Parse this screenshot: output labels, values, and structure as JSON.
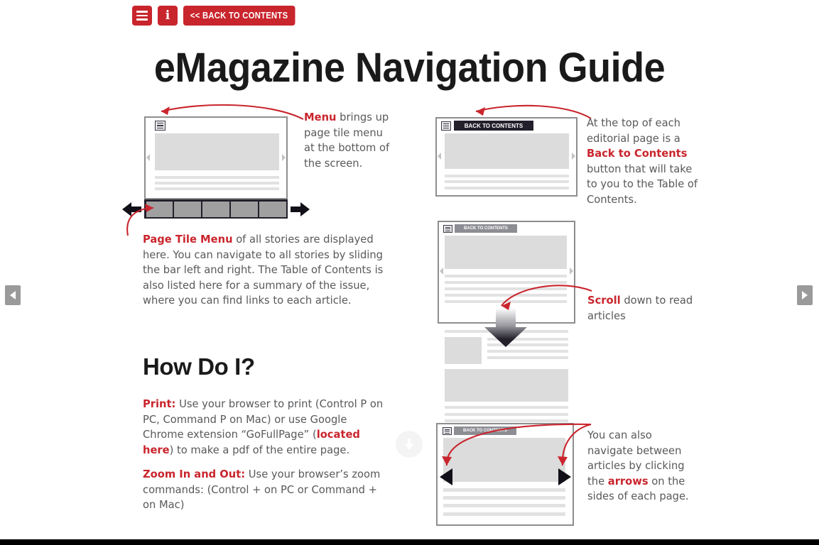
{
  "toolbar": {
    "menu_icon": "hamburger-menu-icon",
    "info_icon": "info-icon",
    "back_to_contents_label": "<< BACK TO CONTENTS",
    "accent_color": "#c9252d"
  },
  "header": {
    "title": "eMagazine Navigation Guide"
  },
  "captions": {
    "menu": {
      "strong": "Menu",
      "rest": " brings up page tile menu at the bottom of the screen."
    },
    "page_tile_menu": {
      "strong": "Page Tile Menu",
      "rest": " of all stories are displayed here. You can navigate to all stories by sliding the bar left and right. The Table of Contents is also listed here for a summary of the issue, where you can find links to each article."
    },
    "back_to_contents": {
      "pre": "At the top of each editorial page is a ",
      "strong": "Back to Contents",
      "post": " button that will take to you to the Table of Contents."
    },
    "scroll": {
      "strong": "Scroll",
      "rest": " down to read articles"
    },
    "arrows": {
      "pre": "You can also navigate between articles by clicking the ",
      "strong": "arrows",
      "post": " on the sides of each page."
    }
  },
  "how_do_i": {
    "heading": "How Do I?",
    "print": {
      "strong": "Print:",
      "part1": " Use your browser to print (Control P on PC, Command P on Mac) or use Google Chrome extension “GoFullPage” (",
      "link": "located here",
      "part2": ") to make a pdf of the entire page."
    },
    "zoom": {
      "strong": "Zoom In and Out:",
      "rest": " Use your browser’s zoom commands: (Control + on PC or Command + on Mac)"
    }
  },
  "mockups": {
    "back_to_contents_pill": "BACK TO CONTENTS",
    "tile_count": 5,
    "menu_icon": "hamburger-menu-icon",
    "prev_arrow_icon": "arrow-left-icon",
    "next_arrow_icon": "arrow-right-icon",
    "scroll_arrow_icon": "arrow-down-icon"
  },
  "edge_nav": {
    "prev_icon": "chevron-left-icon",
    "next_icon": "chevron-right-icon"
  },
  "scroll_hint": {
    "icon": "scroll-down-circle-icon"
  },
  "colors": {
    "accent_red": "#c9252d",
    "body_gray": "#58595b",
    "mock_border": "#8e8e8e",
    "mock_fill": "#dcdcdc",
    "dark": "#231f2b"
  }
}
